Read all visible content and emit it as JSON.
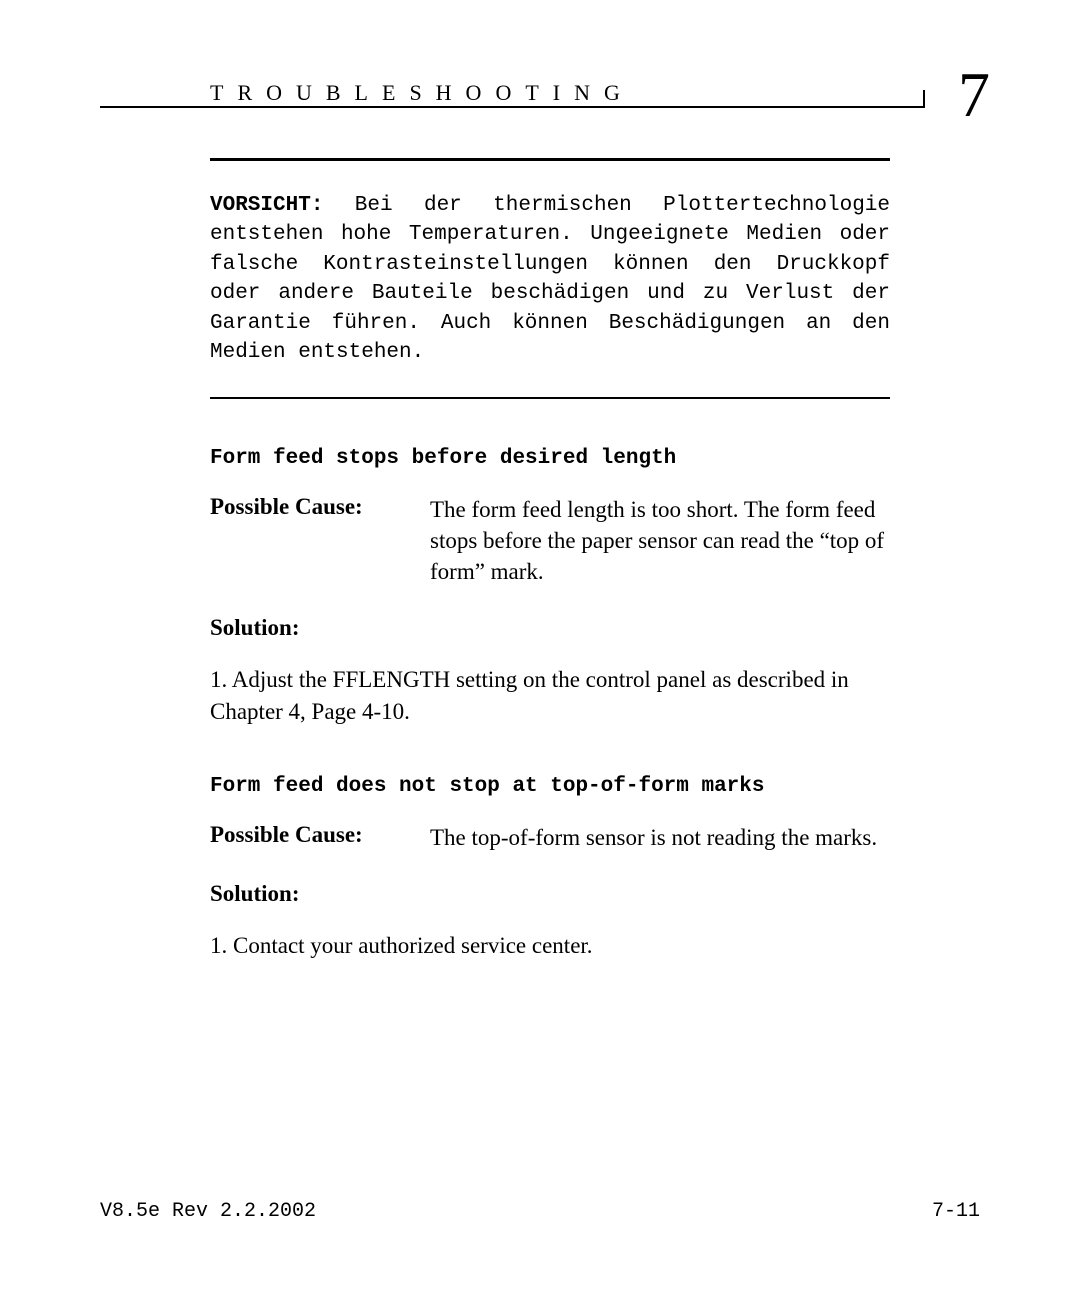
{
  "header": {
    "title": "TROUBLESHOOTING",
    "chapter_number": "7"
  },
  "warning": {
    "label": "VORSICHT:",
    "text": " Bei der thermischen Plottertechnologie entstehen hohe Temperaturen. Ungeeignete Medien oder falsche Kontrasteinstellungen können den Druckkopf oder andere Bauteile beschädigen und zu Verlust der Garantie führen. Auch können Beschädigungen an den Medien  entstehen."
  },
  "sections": [
    {
      "heading": "Form feed stops before desired length",
      "possible_cause_label": "Possible Cause:",
      "possible_cause": "The form feed length is too short. The form feed stops before the paper sensor can read the “top of form” mark.",
      "solution_label": "Solution:",
      "solution": "1.  Adjust the FFLENGTH setting on the control panel as described in Chapter 4, Page 4-10."
    },
    {
      "heading": "Form feed does not stop at top-of-form marks",
      "possible_cause_label": "Possible Cause:",
      "possible_cause": "The top-of-form sensor is not reading the marks.",
      "solution_label": "Solution:",
      "solution": "1.  Contact your authorized service center."
    }
  ],
  "footer": {
    "version": "V8.5e Rev 2.2.2002",
    "page": "7-11"
  }
}
